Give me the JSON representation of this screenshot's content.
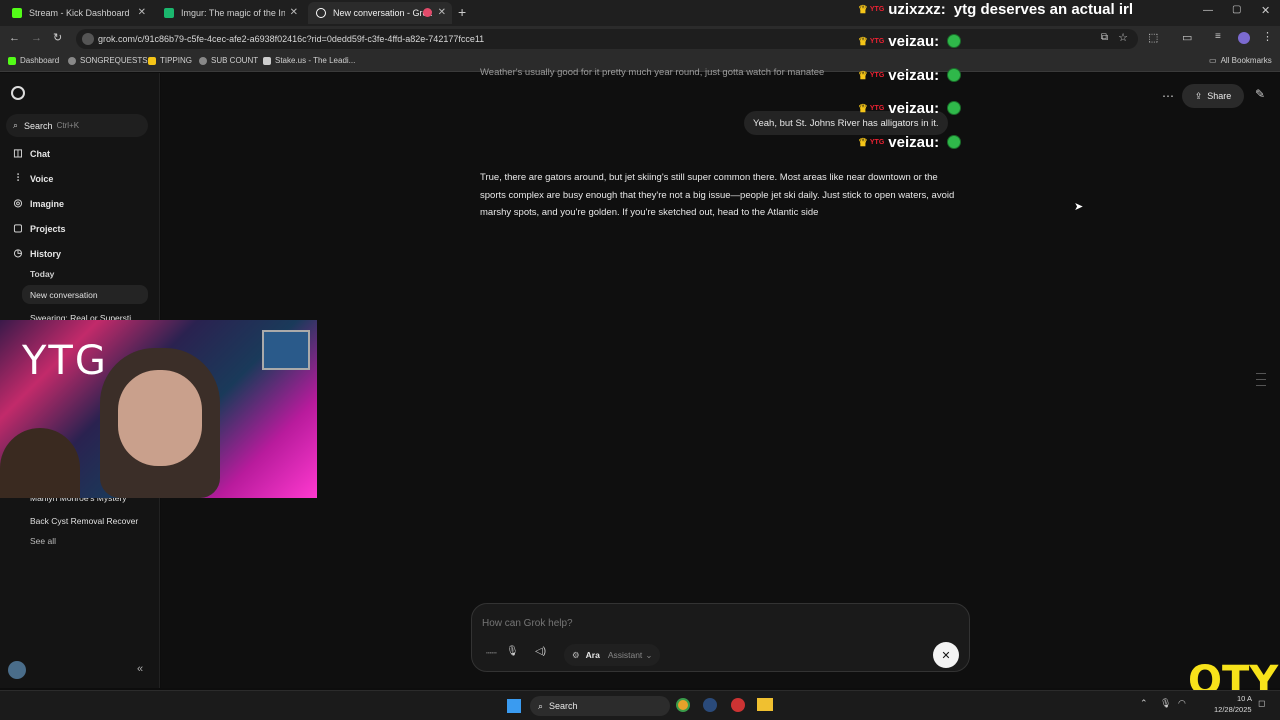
{
  "tabs": [
    {
      "title": "Stream - Kick Dashboard",
      "favicon_color": "#53fc18"
    },
    {
      "title": "Imgur: The magic of the Interne",
      "favicon_color": "#1bb76e"
    },
    {
      "title": "New conversation - Grok",
      "favicon_color": "#ffffff",
      "active": true
    }
  ],
  "address": {
    "url": "grok.com/c/91c86b79-c5fe-4cec-afe2-a6938f02416c?rid=0dedd59f-c3fe-4ffd-a82e-742177fcce11"
  },
  "bookmarks": [
    {
      "label": "Dashboard",
      "color": "#53fc18"
    },
    {
      "label": "SONGREQUESTS",
      "color": "#888888"
    },
    {
      "label": "TIPPING",
      "color": "#f5c518"
    },
    {
      "label": "SUB COUNT",
      "color": "#888888"
    },
    {
      "label": "Stake.us - The Leadi...",
      "color": "#cccccc"
    }
  ],
  "bookmarks_right": "All Bookmarks",
  "sidebar": {
    "search_label": "Search",
    "search_shortcut": "Ctrl+K",
    "nav": [
      {
        "label": "Chat",
        "icon": "chat-icon"
      },
      {
        "label": "Voice",
        "icon": "voice-icon"
      },
      {
        "label": "Imagine",
        "icon": "imagine-icon"
      },
      {
        "label": "Projects",
        "icon": "projects-icon"
      },
      {
        "label": "History",
        "icon": "history-icon"
      }
    ],
    "history_group": "Today",
    "history": [
      {
        "label": "New conversation"
      },
      {
        "label": "Swearing: Real or Supersti"
      },
      {
        "label": "Marilyn Monroe's Mystery"
      },
      {
        "label": "Back Cyst Removal Recover"
      }
    ],
    "see_all": "See all"
  },
  "header": {
    "share_label": "Share"
  },
  "conversation": {
    "cut_off_line": "Weather's usually good for it pretty much year round, just gotta watch for manatee",
    "user_message": "Yeah, but St. Johns River has alligators in it.",
    "assistant_message": "True, there are gators around, but jet skiing's still super common there. Most areas like near downtown or the sports complex are busy enough that they're not a big issue—people jet ski daily. Just stick to open waters, avoid marshy spots, and you're golden. If you're sketched out, head to the Atlantic side"
  },
  "composer": {
    "placeholder": "How can Grok help?",
    "voice_name": "Ara",
    "voice_role": "Assistant"
  },
  "chat_overlay": [
    {
      "user": "uzixzxz:",
      "message": "ytg deserves an actual irl"
    },
    {
      "user": "veizau:",
      "message": ""
    },
    {
      "user": "veizau:",
      "message": ""
    },
    {
      "user": "veizau:",
      "message": ""
    },
    {
      "user": "veizau:",
      "message": ""
    }
  ],
  "webcam": {
    "sign_text": "YTG"
  },
  "taskbar": {
    "search_label": "Search",
    "time": "10 A",
    "date": "12/28/2025"
  },
  "logo_text": "OTY"
}
